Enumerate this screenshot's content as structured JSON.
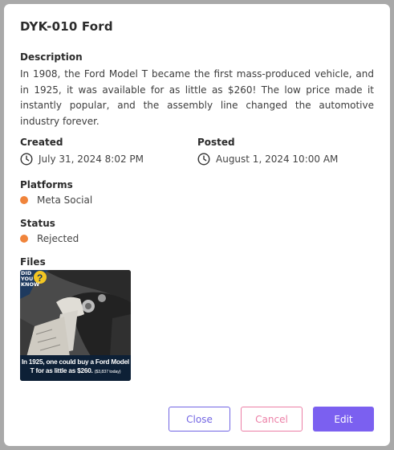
{
  "modal": {
    "title": "DYK-010 Ford",
    "description_label": "Description",
    "description": "In 1908, the Ford Model T became the first mass-produced vehicle, and in 1925, it was available for as little as $260! The low price made it instantly popular, and the assembly line changed the automotive industry forever.",
    "created_label": "Created",
    "created_value": "July 31, 2024 8:02 PM",
    "posted_label": "Posted",
    "posted_value": "August 1, 2024 10:00 AM",
    "platforms_label": "Platforms",
    "platform": "Meta Social",
    "status_label": "Status",
    "status": "Rejected",
    "files_label": "Files",
    "file": {
      "badge": "DID YOU KNOW",
      "caption": "In 1925, one could buy a Ford Model T for as little as $260.",
      "caption_note": "($3,837 today)"
    },
    "buttons": {
      "close": "Close",
      "cancel": "Cancel",
      "edit": "Edit"
    }
  },
  "colors": {
    "accent": "#7b60f0",
    "close_border": "#7265e3",
    "cancel_border": "#ec7fa6",
    "status_dot": "#f0843b"
  }
}
